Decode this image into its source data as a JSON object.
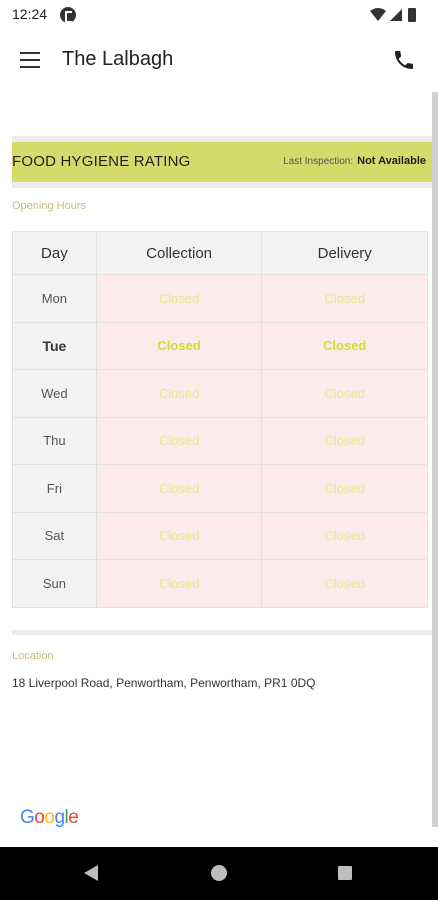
{
  "status_bar": {
    "time": "12:24"
  },
  "app_bar": {
    "title": "The Lalbagh"
  },
  "hygiene": {
    "title": "FOOD HYGIENE RATING",
    "inspection_label": "Last Inspection:",
    "inspection_value": "Not Available",
    "bar_color": "#d6da6a"
  },
  "opening_hours": {
    "label": "Opening Hours",
    "headers": {
      "day": "Day",
      "collection": "Collection",
      "delivery": "Delivery"
    },
    "rows": [
      {
        "day": "Mon",
        "collection": "Closed",
        "delivery": "Closed"
      },
      {
        "day": "Tue",
        "collection": "Closed",
        "delivery": "Closed"
      },
      {
        "day": "Wed",
        "collection": "Closed",
        "delivery": "Closed"
      },
      {
        "day": "Thu",
        "collection": "Closed",
        "delivery": "Closed"
      },
      {
        "day": "Fri",
        "collection": "Closed",
        "delivery": "Closed"
      },
      {
        "day": "Sat",
        "collection": "Closed",
        "delivery": "Closed"
      },
      {
        "day": "Sun",
        "collection": "Closed",
        "delivery": "Closed"
      }
    ],
    "highlighted_day": "Tue",
    "closed_color": "#d2dd3c"
  },
  "location": {
    "label": "Location",
    "address": "18 Liverpool Road, Penwortham, Penwortham, PR1 0DQ"
  },
  "attribution": {
    "logo_letters": [
      "G",
      "o",
      "o",
      "g",
      "l",
      "e"
    ]
  },
  "icons": {
    "menu": "menu-icon",
    "phone": "phone-icon",
    "nav_back": "back-icon",
    "nav_home": "home-icon",
    "nav_recents": "recents-icon"
  }
}
